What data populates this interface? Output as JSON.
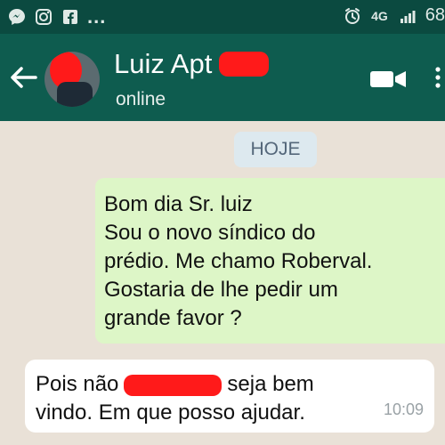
{
  "status_bar": {
    "left_icons": [
      "messenger-icon",
      "instagram-icon",
      "facebook-icon"
    ],
    "ellipsis": "...",
    "network": "4G",
    "battery_text": "68"
  },
  "header": {
    "contact_name": "Luiz Apt",
    "status": "online"
  },
  "chat": {
    "date_chip": "HOJE",
    "outgoing": {
      "lines": [
        "Bom dia Sr. luiz",
        "Sou o novo síndico do",
        "prédio. Me chamo Roberval.",
        "Gostaria de lhe pedir um",
        "grande favor ?"
      ]
    },
    "incoming": {
      "line1_before": "Pois não",
      "line1_after": "seja bem",
      "line2": "vindo. Em que posso ajudar.",
      "time": "10:09"
    }
  },
  "colors": {
    "status_bar": "#0b4a40",
    "app_bar": "#0e5c4f",
    "chat_bg": "#e9e1d7",
    "outgoing_bubble": "#ddf6c7",
    "incoming_bubble": "#ffffff",
    "redaction": "#ff1a1a"
  }
}
